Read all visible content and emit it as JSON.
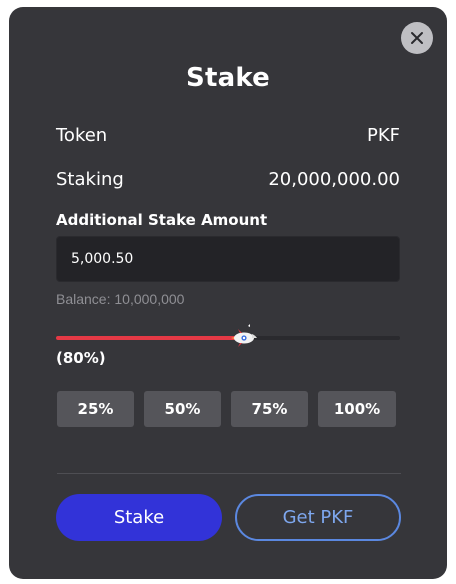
{
  "modal": {
    "title": "Stake",
    "close_icon": "close-icon",
    "rows": [
      {
        "label": "Token",
        "value": "PKF"
      },
      {
        "label": "Staking",
        "value": "20,000,000.00"
      }
    ],
    "amount_label": "Additional Stake Amount",
    "amount_value": "5,000.50",
    "balance": "Balance: 10,000,000",
    "slider": {
      "value_percent": 54,
      "thumb_icon": "rocket-icon"
    },
    "percent_label": "(80%)",
    "presets": [
      "25%",
      "50%",
      "75%",
      "100%"
    ],
    "stake_button": "Stake",
    "get_button": "Get PKF",
    "colors": {
      "background": "#36363a",
      "slider_fill": "#e53945",
      "primary_button": "#3233d8",
      "secondary_border": "#5b88e0"
    }
  }
}
